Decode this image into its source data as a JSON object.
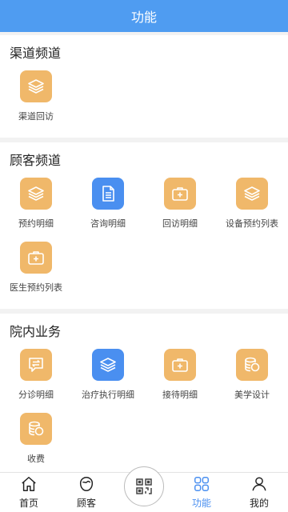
{
  "header": {
    "title": "功能"
  },
  "sections": [
    {
      "title": "渠道频道",
      "items": [
        {
          "label": "渠道回访",
          "icon": "layers-icon",
          "color": "#f0b86a"
        }
      ]
    },
    {
      "title": "顾客频道",
      "items": [
        {
          "label": "预约明细",
          "icon": "layers-icon",
          "color": "#f0b86a"
        },
        {
          "label": "咨询明细",
          "icon": "document-icon",
          "color": "#4a8ff0"
        },
        {
          "label": "回访明细",
          "icon": "medkit-icon",
          "color": "#f0b86a"
        },
        {
          "label": "设备预约列表",
          "icon": "layers-icon",
          "color": "#f0b86a"
        },
        {
          "label": "医生预约列表",
          "icon": "medkit-icon",
          "color": "#f0b86a"
        }
      ]
    },
    {
      "title": "院内业务",
      "items": [
        {
          "label": "分诊明细",
          "icon": "chat-transfer-icon",
          "color": "#f0b86a"
        },
        {
          "label": "治疗执行明细",
          "icon": "layers-icon",
          "color": "#4a8ff0"
        },
        {
          "label": "接待明细",
          "icon": "medkit-icon",
          "color": "#f0b86a"
        },
        {
          "label": "美学设计",
          "icon": "coins-icon",
          "color": "#f0b86a"
        },
        {
          "label": "收费",
          "icon": "coins-icon",
          "color": "#f0b86a"
        }
      ]
    }
  ],
  "tabbar": {
    "tabs": [
      {
        "label": "首页",
        "icon": "home-icon"
      },
      {
        "label": "顾客",
        "icon": "customer-icon"
      },
      {
        "label": "",
        "icon": "qr-scan-icon"
      },
      {
        "label": "功能",
        "icon": "grid-icon",
        "active": true
      },
      {
        "label": "我的",
        "icon": "person-icon"
      }
    ]
  },
  "colors": {
    "primary": "#4f9cf1",
    "accent_orange": "#f0b86a",
    "accent_blue": "#4a8ff0"
  }
}
